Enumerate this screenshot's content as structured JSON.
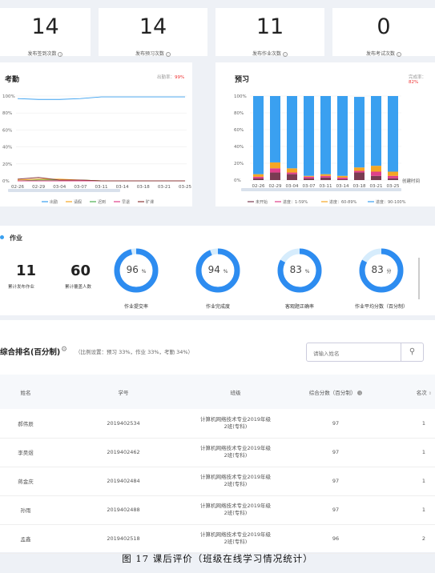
{
  "stats": [
    {
      "value": "14",
      "label": "发布签到次数"
    },
    {
      "value": "14",
      "label": "发布预习次数"
    },
    {
      "value": "11",
      "label": "发布作业次数"
    },
    {
      "value": "0",
      "label": "发布考试次数"
    }
  ],
  "attendance_chart": {
    "title": "考勤",
    "rate_label": "出勤率：",
    "rate_value": "99%"
  },
  "preview_chart": {
    "title": "预习",
    "rate_label": "完成率：",
    "rate_value": "82%",
    "corner_label": "创建时间"
  },
  "chart_data": [
    {
      "type": "line",
      "x": [
        "02-26",
        "02-29",
        "03-04",
        "03-07",
        "03-11",
        "03-14",
        "03-18",
        "03-21",
        "03-25"
      ],
      "ylim": [
        0,
        100
      ],
      "yticks": [
        "0%",
        "20%",
        "40%",
        "60%",
        "80%",
        "100%"
      ],
      "series": [
        {
          "name": "出勤",
          "color": "#3aa0f0",
          "values": [
            97,
            96,
            96,
            97,
            99,
            99,
            99,
            99,
            99
          ]
        },
        {
          "name": "请假",
          "color": "#f5a623",
          "values": [
            1,
            2,
            2,
            1,
            0,
            0,
            0,
            0,
            0
          ]
        },
        {
          "name": "迟到",
          "color": "#4caf50",
          "values": [
            0,
            1,
            1,
            1,
            0,
            0,
            0,
            0,
            0
          ]
        },
        {
          "name": "早退",
          "color": "#e0408a",
          "values": [
            0,
            0,
            0,
            0,
            0,
            0,
            0,
            0,
            0
          ]
        },
        {
          "name": "旷课",
          "color": "#8b3a3a",
          "values": [
            2,
            4,
            1,
            1,
            0,
            0,
            0,
            0,
            0
          ]
        }
      ]
    },
    {
      "type": "bar",
      "stacked": true,
      "categories": [
        "02-26",
        "02-29",
        "03-04",
        "03-07",
        "03-11",
        "03-14",
        "03-18",
        "03-21",
        "03-25"
      ],
      "ylim": [
        0,
        100
      ],
      "yticks": [
        "0%",
        "20%",
        "40%",
        "60%",
        "80%",
        "100%"
      ],
      "series": [
        {
          "name": "未开始",
          "color": "#7a3b52",
          "values": [
            2,
            9,
            7,
            2,
            3,
            1,
            9,
            5,
            2
          ]
        },
        {
          "name": "进度：1-59%",
          "color": "#e0408a",
          "values": [
            2,
            5,
            2,
            2,
            2,
            2,
            2,
            5,
            3
          ]
        },
        {
          "name": "进度：60-89%",
          "color": "#f5a623",
          "values": [
            3,
            7,
            5,
            1,
            2,
            2,
            4,
            7,
            5
          ]
        },
        {
          "name": "进度：90-100%",
          "color": "#3aa0f0",
          "values": [
            93,
            79,
            86,
            95,
            93,
            95,
            84,
            83,
            90
          ]
        }
      ]
    }
  ],
  "homework": {
    "title": "作业",
    "published_count": "11",
    "published_label": "累计发布作业",
    "covered_count": "60",
    "covered_label": "累计覆盖人数",
    "rings": [
      {
        "value": "96",
        "unit": "%",
        "fraction": 0.96,
        "label": "作业提交率"
      },
      {
        "value": "94",
        "unit": "%",
        "fraction": 0.94,
        "label": "作业完成度"
      },
      {
        "value": "83",
        "unit": "%",
        "fraction": 0.83,
        "label": "客观题正确率"
      },
      {
        "value": "83",
        "unit": "分",
        "fraction": 0.83,
        "label": "作业平均分数（百分制）"
      }
    ]
  },
  "ranking": {
    "title": "综合排名(百分制)",
    "note": "（比例设置：预习 33%，作业 33%，考勤 34%）",
    "search_placeholder": "请输入姓名",
    "columns": [
      "姓名",
      "学号",
      "班级",
      "综合分数（百分制）",
      "名次"
    ],
    "rows": [
      {
        "name": "郝伟辰",
        "id": "2019402534",
        "class": "计算机网络技术专业2019年级2班(专科)",
        "score": "97",
        "rank": "1"
      },
      {
        "name": "李昊煜",
        "id": "2019402462",
        "class": "计算机网络技术专业2019年级2班(专科)",
        "score": "97",
        "rank": "1"
      },
      {
        "name": "蒋金庆",
        "id": "2019402484",
        "class": "计算机网络技术专业2019年级2班(专科)",
        "score": "97",
        "rank": "1"
      },
      {
        "name": "孙雨",
        "id": "2019402488",
        "class": "计算机网络技术专业2019年级2班(专科)",
        "score": "97",
        "rank": "1"
      },
      {
        "name": "孟鑫",
        "id": "2019402518",
        "class": "计算机网络技术专业2019年级2班(专科)",
        "score": "96",
        "rank": "2"
      }
    ]
  },
  "caption": "图 17 课后评价（班级在线学习情况统计）"
}
